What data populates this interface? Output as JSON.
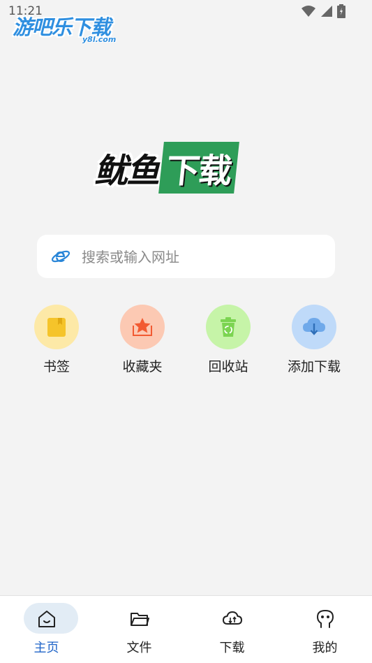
{
  "status_bar": {
    "time": "11:21"
  },
  "watermark": {
    "main": "游吧乐下载",
    "sub": "y8l.com"
  },
  "logo": {
    "part1": "鱿鱼",
    "part2": "下载"
  },
  "search": {
    "placeholder": "搜索或输入网址",
    "value": ""
  },
  "shortcuts": [
    {
      "label": "书签",
      "icon": "bookmark-icon",
      "bg": "#fde9a7",
      "color": "#f5c42a"
    },
    {
      "label": "收藏夹",
      "icon": "star-favorites-icon",
      "bg": "#fcc9b3",
      "color": "#f25a32"
    },
    {
      "label": "回收站",
      "icon": "recycle-bin-icon",
      "bg": "#c6f4a8",
      "color": "#7bd451"
    },
    {
      "label": "添加下载",
      "icon": "cloud-download-icon",
      "bg": "#bfdaf9",
      "color": "#6fa9ea"
    }
  ],
  "bottom_nav": [
    {
      "label": "主页",
      "icon": "home-icon",
      "active": true
    },
    {
      "label": "文件",
      "icon": "folder-icon",
      "active": false
    },
    {
      "label": "下载",
      "icon": "cloud-transfer-icon",
      "active": false
    },
    {
      "label": "我的",
      "icon": "profile-face-icon",
      "active": false
    }
  ],
  "colors": {
    "accent": "#1f64c8",
    "logo_green": "#2e9d58",
    "background": "#f3f3f3"
  }
}
